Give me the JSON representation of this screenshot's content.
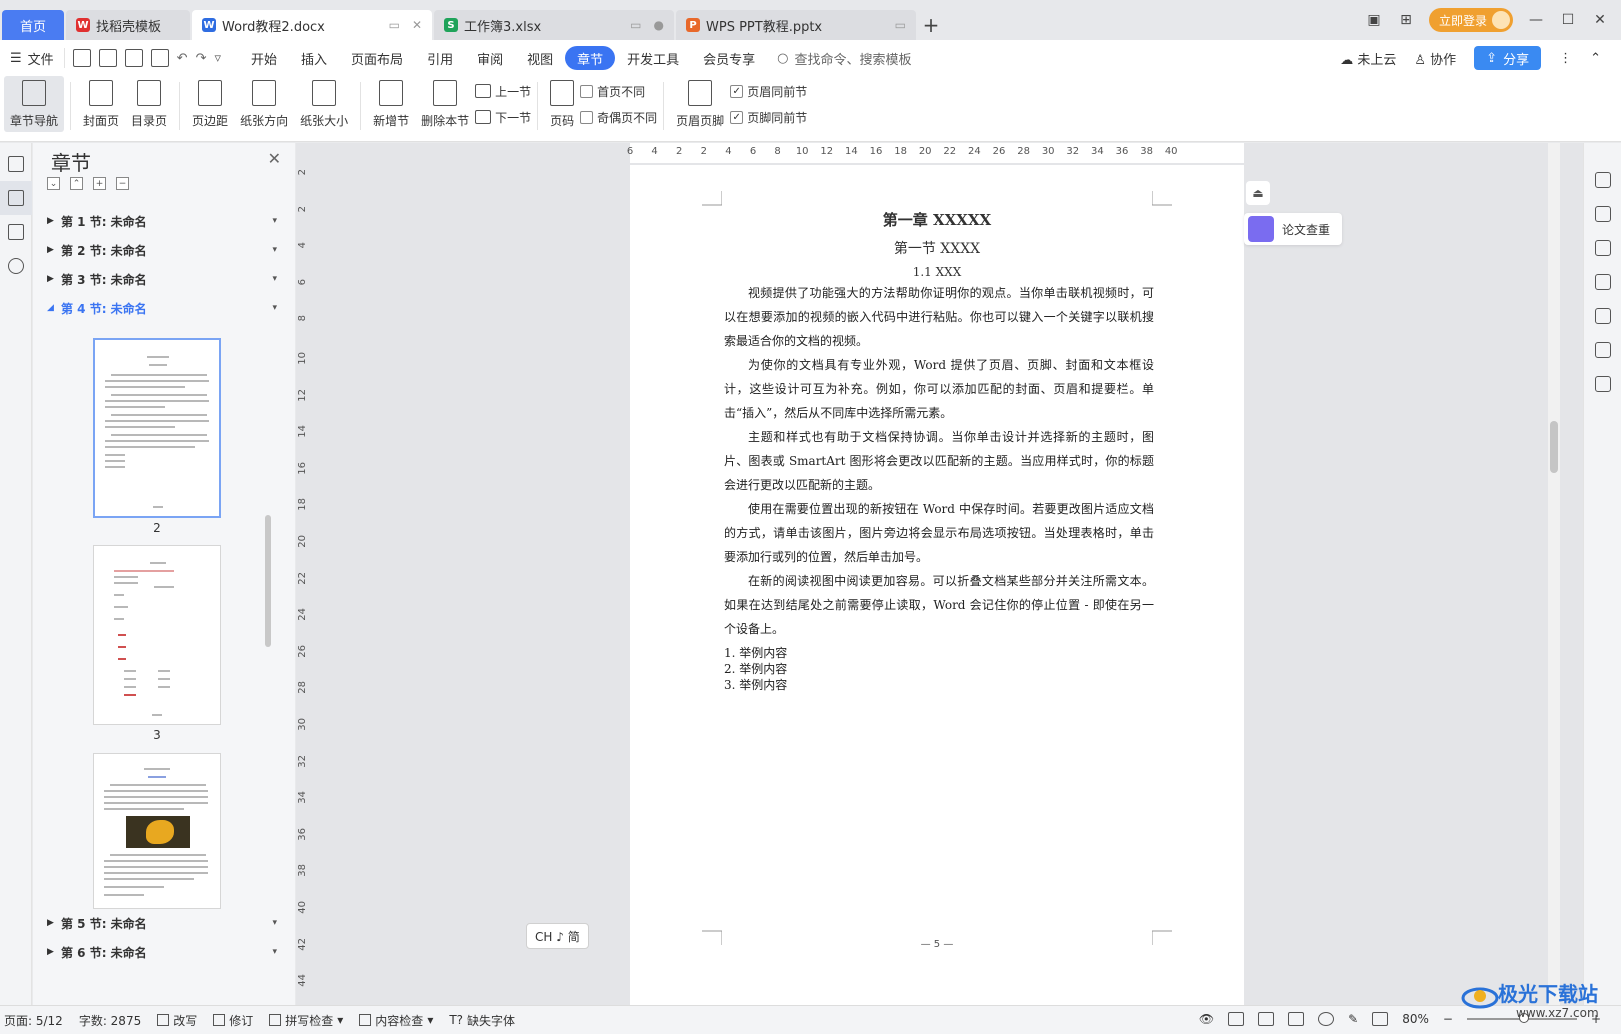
{
  "tabs": {
    "home": "首页",
    "items": [
      {
        "label": "找稻壳模板",
        "icon_color": "#e03030",
        "icon_char": "W"
      },
      {
        "label": "Word教程2.docx",
        "icon_color": "#2f6de1",
        "icon_char": "W"
      },
      {
        "label": "工作簿3.xlsx",
        "icon_color": "#1fa35a",
        "icon_char": "S"
      },
      {
        "label": "WPS PPT教程.pptx",
        "icon_color": "#e8682a",
        "icon_char": "P"
      }
    ],
    "add": "+"
  },
  "window": {
    "login": "立即登录",
    "minimize": "—",
    "maximize": "☐",
    "close": "✕"
  },
  "menubar": {
    "file": "文件",
    "menus": [
      "开始",
      "插入",
      "页面布局",
      "引用",
      "审阅",
      "视图",
      "章节",
      "开发工具",
      "会员专享"
    ],
    "active_menu": "章节",
    "search": "查找命令、搜索模板",
    "cloud": "未上云",
    "collab": "协作",
    "share": "分享"
  },
  "ribbon": {
    "nav": "章节导航",
    "cover": "封面页",
    "toc": "目录页",
    "margin": "页边距",
    "orientation": "纸张方向",
    "size": "纸张大小",
    "new_section": "新增节",
    "delete_section": "删除本节",
    "prev_section": "上一节",
    "next_section": "下一节",
    "page_number": "页码",
    "first_diff": "首页不同",
    "odd_even_diff": "奇偶页不同",
    "header_footer": "页眉页脚",
    "header_same": "页眉同前节",
    "footer_same": "页脚同前节"
  },
  "panel": {
    "title": "章节",
    "sections": [
      {
        "label": "第 1 节: 未命名"
      },
      {
        "label": "第 2 节: 未命名"
      },
      {
        "label": "第 3 节: 未命名"
      },
      {
        "label": "第 4 节: 未命名"
      },
      {
        "label": "第 5 节: 未命名"
      },
      {
        "label": "第 6 节: 未命名"
      }
    ],
    "thumb_numbers": [
      "2",
      "3"
    ]
  },
  "ruler": {
    "h_ticks": [
      "6",
      "4",
      "2",
      "2",
      "4",
      "6",
      "8",
      "10",
      "12",
      "14",
      "16",
      "18",
      "20",
      "22",
      "24",
      "26",
      "28",
      "30",
      "32",
      "34",
      "36",
      "38",
      "40"
    ],
    "v_ticks": [
      "2",
      "2",
      "4",
      "6",
      "8",
      "10",
      "12",
      "14",
      "16",
      "18",
      "20",
      "22",
      "24",
      "26",
      "28",
      "30",
      "32",
      "34",
      "36",
      "38",
      "40",
      "42",
      "44"
    ]
  },
  "document": {
    "h1": "第一章  XXXXX",
    "h2": "第一节  XXXX",
    "h3": "1.1 XXX",
    "paragraphs": [
      "视频提供了功能强大的方法帮助你证明你的观点。当你单击联机视频时，可以在想要添加的视频的嵌入代码中进行粘贴。你也可以键入一个关键字以联机搜索最适合你的文档的视频。",
      "为使你的文档具有专业外观，Word 提供了页眉、页脚、封面和文本框设计，这些设计可互为补充。例如，你可以添加匹配的封面、页眉和提要栏。单击“插入”，然后从不同库中选择所需元素。",
      "主题和样式也有助于文档保持协调。当你单击设计并选择新的主题时，图片、图表或 SmartArt 图形将会更改以匹配新的主题。当应用样式时，你的标题会进行更改以匹配新的主题。",
      "使用在需要位置出现的新按钮在 Word 中保存时间。若要更改图片适应文档的方式，请单击该图片，图片旁边将会显示布局选项按钮。当处理表格时，单击要添加行或列的位置，然后单击加号。",
      "在新的阅读视图中阅读更加容易。可以折叠文档某些部分并关注所需文本。如果在达到结尾处之前需要停止读取，Word 会记住你的停止位置 - 即使在另一个设备上。"
    ],
    "list": [
      "1. 举例内容",
      "2. 举例内容",
      "3. 举例内容"
    ],
    "footer": "— 5 —"
  },
  "floating": {
    "lunwen": "论文查重",
    "ime": "CH ♪ 简"
  },
  "status": {
    "page": "页面: 5/12",
    "words": "字数: 2875",
    "overwrite": "改写",
    "revise": "修订",
    "spell": "拼写检查",
    "content_check": "内容检查",
    "missing_font": "缺失字体",
    "zoom": "80%"
  },
  "watermark": {
    "text": "极光下载站",
    "url": "www.xz7.com"
  }
}
